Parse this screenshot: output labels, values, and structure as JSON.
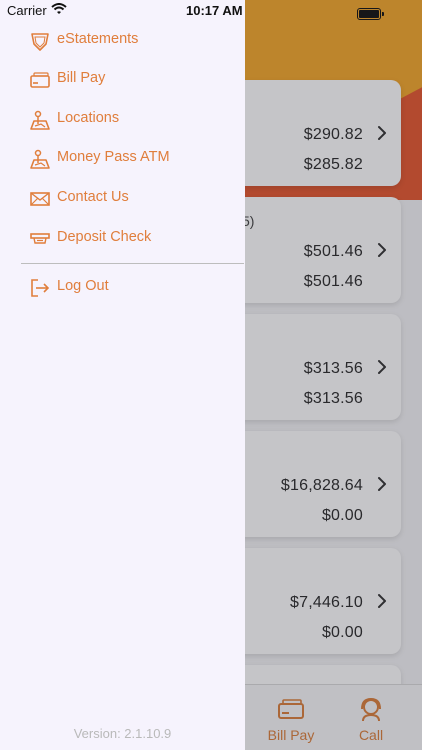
{
  "status_bar": {
    "carrier": "Carrier",
    "time": "10:17 AM"
  },
  "drawer": {
    "menu_items": [
      {
        "label": "eStatements",
        "icon": "shield-icon"
      },
      {
        "label": "Bill Pay",
        "icon": "card-icon"
      },
      {
        "label": "Locations",
        "icon": "map-icon"
      },
      {
        "label": "Money Pass ATM",
        "icon": "map-icon"
      },
      {
        "label": "Contact Us",
        "icon": "envelope-icon"
      },
      {
        "label": "Deposit Check",
        "icon": "check-scanner-icon"
      }
    ],
    "logout": {
      "label": "Log Out",
      "icon": "logout-icon"
    },
    "version": "Version: 2.1.10.9"
  },
  "accounts": [
    {
      "partial_text": "",
      "current": "$290.82",
      "available": "$285.82"
    },
    {
      "partial_text": "5)",
      "current": "$501.46",
      "available": "$501.46"
    },
    {
      "partial_text": "",
      "current": "$313.56",
      "available": "$313.56"
    },
    {
      "partial_text": "",
      "current": "$16,828.64",
      "available": "$0.00"
    },
    {
      "partial_text": "",
      "current": "$7,446.10",
      "available": "$0.00"
    }
  ],
  "tabbar": {
    "tabs": [
      {
        "label": "Bill Pay",
        "icon": "card-icon"
      },
      {
        "label": "Call",
        "icon": "headset-icon"
      }
    ]
  },
  "colors": {
    "accent": "#e07e3c",
    "hero_red": "#e4572e",
    "hero_orange": "#f2a62a",
    "drawer_bg": "#f6f3fd"
  }
}
